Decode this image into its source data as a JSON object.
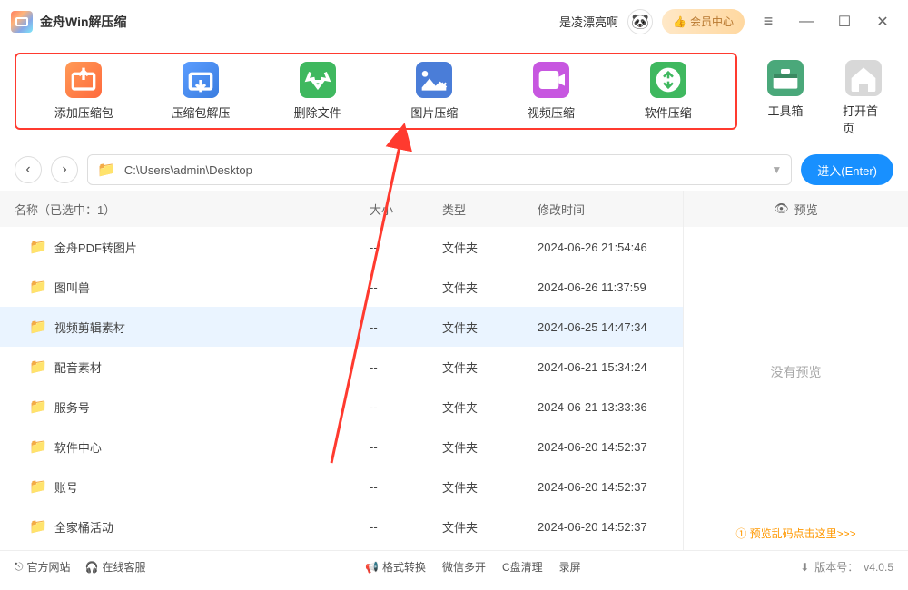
{
  "app": {
    "title": "金舟Win解压缩"
  },
  "titlebar": {
    "greeting": "是凌漂亮啊",
    "member_button": "会员中心"
  },
  "toolbar": {
    "add": "添加压缩包",
    "extract": "压缩包解压",
    "delete": "删除文件",
    "image": "图片压缩",
    "video": "视频压缩",
    "software": "软件压缩",
    "toolbox": "工具箱",
    "home": "打开首页"
  },
  "pathbar": {
    "path": "C:\\Users\\admin\\Desktop",
    "enter": "进入(Enter)"
  },
  "columns": {
    "name_label": "名称（已选中：1）",
    "size": "大小",
    "type": "类型",
    "date": "修改时间"
  },
  "files": [
    {
      "name": "金舟PDF转图片",
      "size": "--",
      "type": "文件夹",
      "date": "2024-06-26 21:54:46",
      "selected": false
    },
    {
      "name": "图叫兽",
      "size": "--",
      "type": "文件夹",
      "date": "2024-06-26 11:37:59",
      "selected": false
    },
    {
      "name": "视频剪辑素材",
      "size": "--",
      "type": "文件夹",
      "date": "2024-06-25 14:47:34",
      "selected": true
    },
    {
      "name": "配音素材",
      "size": "--",
      "type": "文件夹",
      "date": "2024-06-21 15:34:24",
      "selected": false
    },
    {
      "name": "服务号",
      "size": "--",
      "type": "文件夹",
      "date": "2024-06-21 13:33:36",
      "selected": false
    },
    {
      "name": "软件中心",
      "size": "--",
      "type": "文件夹",
      "date": "2024-06-20 14:52:37",
      "selected": false
    },
    {
      "name": "账号",
      "size": "--",
      "type": "文件夹",
      "date": "2024-06-20 14:52:37",
      "selected": false
    },
    {
      "name": "全家桶活动",
      "size": "--",
      "type": "文件夹",
      "date": "2024-06-20 14:52:37",
      "selected": false
    }
  ],
  "preview": {
    "header": "预览",
    "empty": "没有预览",
    "garbled_link": "预览乱码点击这里>>>"
  },
  "statusbar": {
    "website": "官方网站",
    "support": "在线客服",
    "format_convert": "格式转换",
    "wechat_multi": "微信多开",
    "cdisk_clean": "C盘清理",
    "screen_record": "录屏",
    "version_label": "版本号：",
    "version": "v4.0.5"
  }
}
